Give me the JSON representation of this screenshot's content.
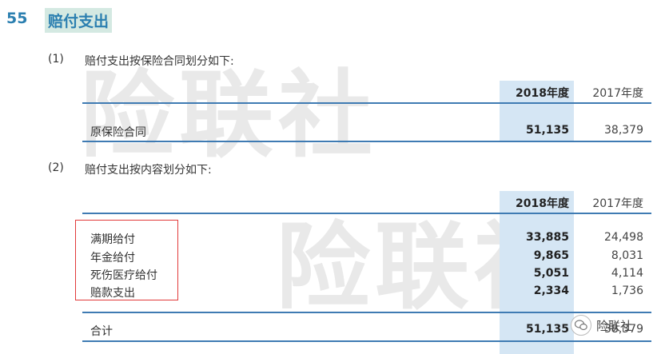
{
  "section": {
    "number": "55",
    "title": "赔付支出"
  },
  "watermark": {
    "text": "险联社"
  },
  "table1": {
    "item_number": "(1)",
    "caption": "赔付支出按保险合同划分如下:",
    "header_2018": "2018年度",
    "header_2017": "2017年度",
    "rows": [
      {
        "label": "原保险合同",
        "v2018": "51,135",
        "v2017": "38,379"
      }
    ]
  },
  "table2": {
    "item_number": "(2)",
    "caption": "赔付支出按内容划分如下:",
    "header_2018": "2018年度",
    "header_2017": "2017年度",
    "rows": [
      {
        "label": "满期给付",
        "v2018": "33,885",
        "v2017": "24,498"
      },
      {
        "label": "年金给付",
        "v2018": "9,865",
        "v2017": "8,031"
      },
      {
        "label": "死伤医疗给付",
        "v2018": "5,051",
        "v2017": "4,114"
      },
      {
        "label": "赔款支出",
        "v2018": "2,334",
        "v2017": "1,736"
      }
    ],
    "total": {
      "label": "合计",
      "v2018": "51,135",
      "v2017": "38,379"
    }
  },
  "brand": {
    "icon": "wechat-icon",
    "name": "险联社"
  },
  "colors": {
    "accent": "#2b7fb0",
    "title_bg": "#d4e9e2",
    "highlight_column": "#d5e6f4",
    "rule": "#3f7bb3",
    "annotation_box": "#e23a3a"
  }
}
